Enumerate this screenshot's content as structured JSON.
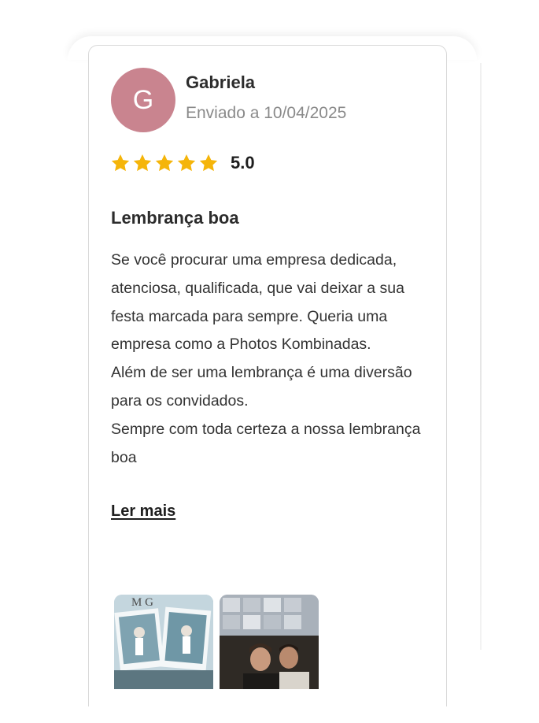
{
  "review": {
    "avatar_initial": "G",
    "author": "Gabriela",
    "sent_date": "Enviado a 10/04/2025",
    "rating": {
      "stars": 5,
      "max_stars": 5,
      "score_text": "5.0",
      "star_color": "#f5b50a"
    },
    "title": "Lembrança boa",
    "body_paragraphs": [
      "Se você procurar uma empresa dedicada, atenciosa, qualificada, que vai deixar a sua festa marcada para sempre. Queria uma empresa como a Photos Kombinadas.",
      "Além de ser uma lembrança é uma diversão para os convidados.",
      "Sempre com toda certeza a nossa lembrança boa"
    ],
    "read_more": "Ler mais",
    "photo_monogram": "M G"
  },
  "colors": {
    "avatar_bg": "#c9848f",
    "card_border": "#d9d9d9",
    "muted_text": "#8a8a8a"
  }
}
